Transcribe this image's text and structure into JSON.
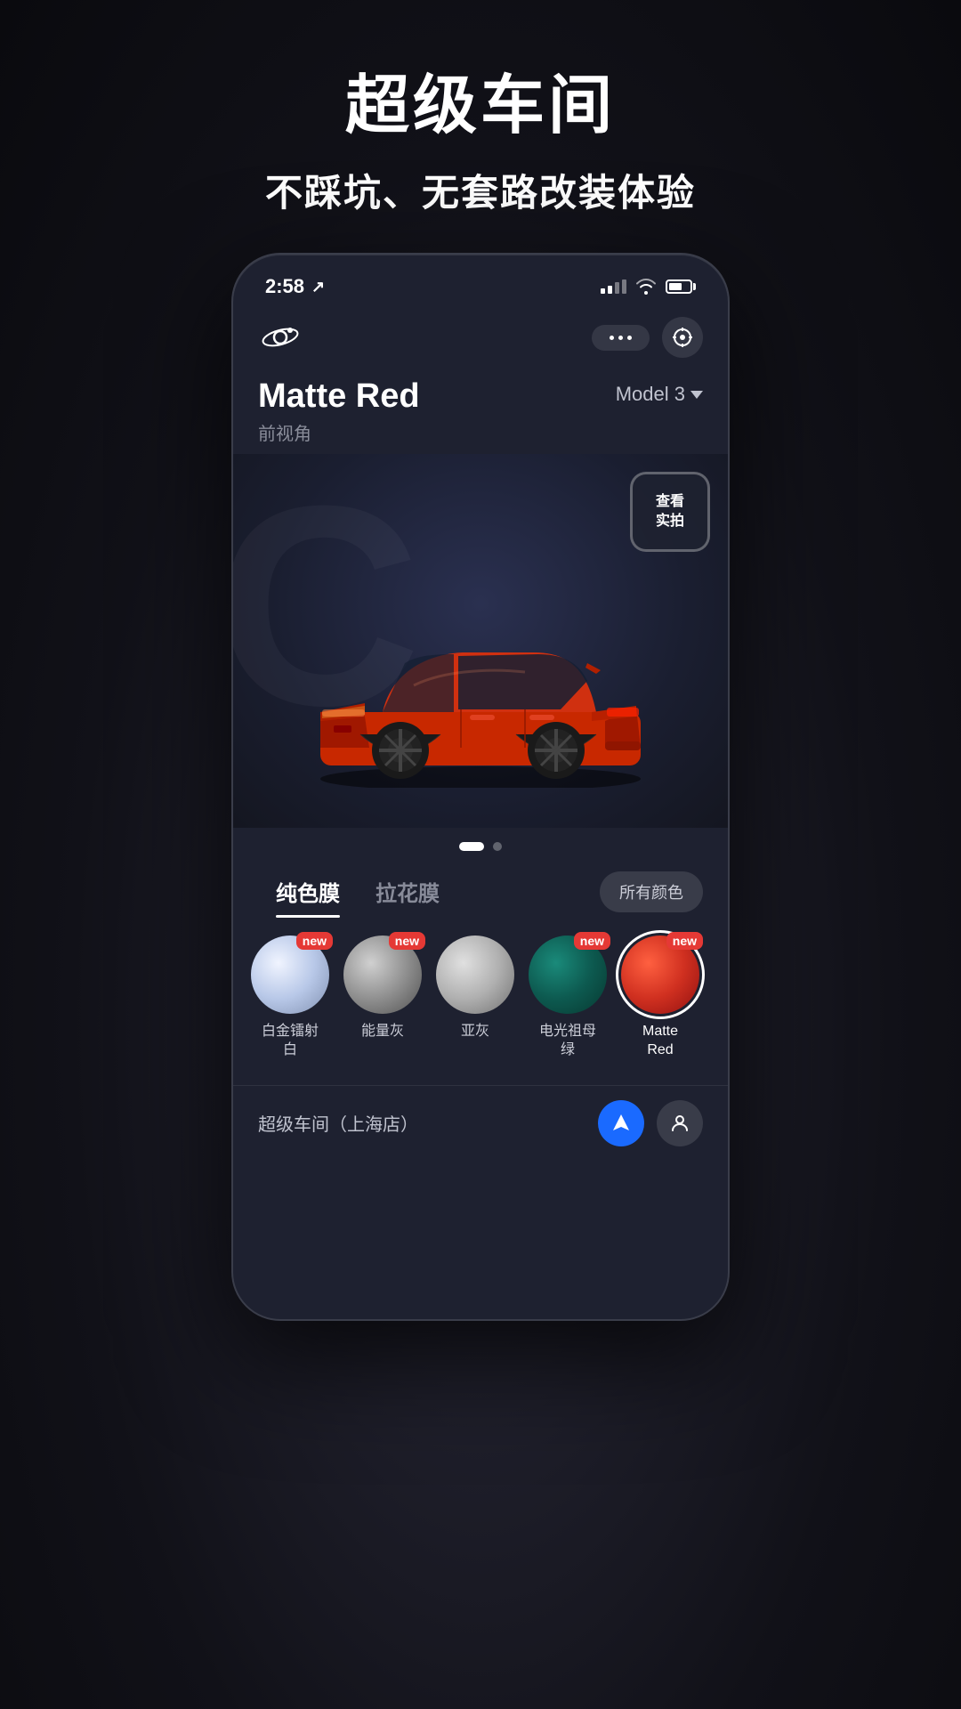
{
  "page": {
    "background": "#111118"
  },
  "header": {
    "title": "超级车间",
    "subtitle": "不踩坑、无套路改装体验"
  },
  "phone": {
    "status_bar": {
      "time": "2:58",
      "location_arrow": "↗"
    },
    "app_header": {
      "dots_label": "•••",
      "target_label": "⊙"
    },
    "car_section": {
      "name": "Matte Red",
      "view_label": "前视角",
      "model": "Model 3",
      "real_photo_btn": "查看\n实拍"
    },
    "tabs": {
      "tab1": "纯色膜",
      "tab2": "拉花膜",
      "all_colors": "所有颜色"
    },
    "colors": [
      {
        "id": "pearl",
        "label": "白金镭射\n白",
        "is_new": true,
        "active": false,
        "class": "swatch-pearl"
      },
      {
        "id": "energy-gray",
        "label": "能量灰",
        "is_new": true,
        "active": false,
        "class": "swatch-gray-energy"
      },
      {
        "id": "sub-gray",
        "label": "亚灰",
        "is_new": false,
        "active": false,
        "class": "swatch-gray-sub"
      },
      {
        "id": "electric-green",
        "label": "电光祖母\n绿",
        "is_new": true,
        "active": false,
        "class": "swatch-green"
      },
      {
        "id": "matte-red",
        "label": "Matte\nRed",
        "is_new": true,
        "active": true,
        "class": "swatch-red"
      }
    ],
    "bottom_bar": {
      "store_name": "超级车间（上海店）"
    }
  }
}
